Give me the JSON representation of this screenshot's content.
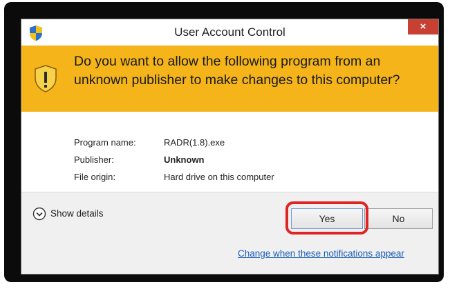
{
  "window": {
    "title": "User Account Control",
    "close_label": "×"
  },
  "banner": {
    "message": "Do you want to allow the following program from an unknown publisher to make changes to this computer?"
  },
  "details": {
    "rows": [
      {
        "label": "Program name:",
        "value": "RADR(1.8).exe"
      },
      {
        "label": "Publisher:",
        "value": "Unknown"
      },
      {
        "label": "File origin:",
        "value": "Hard drive on this computer"
      }
    ]
  },
  "footer": {
    "show_details_label": "Show details",
    "yes_label": "Yes",
    "no_label": "No",
    "change_link": "Change when these notifications appear"
  },
  "colors": {
    "banner": "#f4b41a",
    "close": "#c84031",
    "highlight": "#e02424",
    "link": "#1f5fb7"
  },
  "icons": [
    "uac-shield-icon",
    "warning-shield-icon",
    "chevron-down-icon",
    "close-icon"
  ]
}
